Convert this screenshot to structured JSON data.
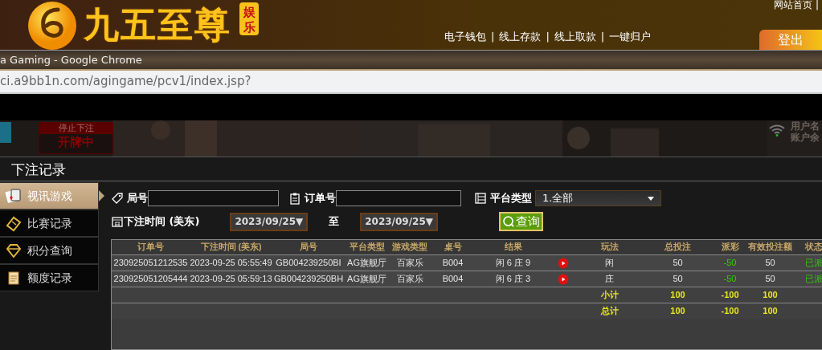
{
  "site_header": {
    "brand": "九五至尊",
    "badge": "娱乐",
    "top_link": "网站首页",
    "separator": "|",
    "nav": [
      "电子钱包",
      "线上存款",
      "线上取款",
      "一键归户"
    ],
    "logout": "登出"
  },
  "browser": {
    "title": "a Gaming - Google Chrome",
    "url": "ci.a9bb1n.com/agingame/pcv1/index.jsp?"
  },
  "game_view": {
    "status_label": "停止下注",
    "status": "开牌中",
    "info_labels": [
      "用户名",
      "账户余"
    ]
  },
  "dialog": {
    "title": "下注记录",
    "sidebar": [
      {
        "label": "视讯游戏",
        "kind": "cards",
        "selected": true
      },
      {
        "label": "比赛记录",
        "kind": "ticket",
        "selected": false
      },
      {
        "label": "积分查询",
        "kind": "diamond",
        "selected": false
      },
      {
        "label": "额度记录",
        "kind": "note",
        "selected": false
      }
    ],
    "filters": {
      "round_label": "局号",
      "order_label": "订单号",
      "platform_label": "平台类型",
      "platform_value": "1.全部",
      "time_label": "下注时间 (美东)",
      "date_from": "2023/09/25",
      "date_to": "2023/09/25",
      "caret": "▼",
      "to_label": "至",
      "search_button": "查询"
    },
    "table": {
      "columns": [
        "订单号",
        "下注时间 (美东)",
        "局号",
        "平台类型",
        "游戏类型",
        "桌号",
        "结果",
        "玩法",
        "总投注",
        "派彩",
        "有效投注额",
        "状态"
      ],
      "rows": [
        {
          "cells": [
            "230925051212535",
            "2023-09-25 05:55:49",
            "GB004239250BI",
            "AG旗舰厅",
            "百家乐",
            "B004",
            "闲 6 庄 9",
            "闲",
            "50",
            "-50",
            "50",
            "已派"
          ]
        },
        {
          "cells": [
            "230925051205444",
            "2023-09-25 05:59:13",
            "GB004239250BH",
            "AG旗舰厅",
            "百家乐",
            "B004",
            "闲 6 庄 3",
            "庄",
            "50",
            "-50",
            "50",
            "已派"
          ]
        }
      ],
      "summary": [
        {
          "label": "小计",
          "total_bet": "100",
          "payout": "-100",
          "valid_bet": "100"
        },
        {
          "label": "总计",
          "total_bet": "100",
          "payout": "-100",
          "valid_bet": "100"
        }
      ]
    }
  }
}
